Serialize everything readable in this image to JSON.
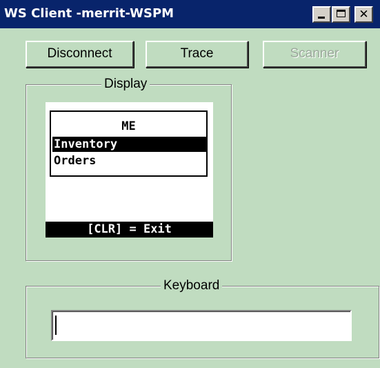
{
  "window": {
    "title": "WS Client -merrit-WSPM",
    "controls": {
      "minimize_icon": "minimize-icon",
      "maximize_icon": "maximize-icon",
      "close_glyph": "✕"
    }
  },
  "toolbar": {
    "disconnect_label": "Disconnect",
    "trace_label": "Trace",
    "scanner_label": "Scanner",
    "scanner_enabled": false
  },
  "display": {
    "legend": "Display",
    "screen_title": "ME",
    "menu_items": [
      {
        "label": "Inventory",
        "selected": true
      },
      {
        "label": "Orders",
        "selected": false
      }
    ],
    "status": "[CLR] = Exit"
  },
  "keyboard": {
    "legend": "Keyboard",
    "value": "",
    "placeholder": ""
  },
  "colors": {
    "window_bg": "#c0dcc0",
    "titlebar_bg": "#08246b",
    "titlebar_text": "#ffffff",
    "screen_bg": "#ffffff",
    "highlight_bg": "#000000"
  }
}
